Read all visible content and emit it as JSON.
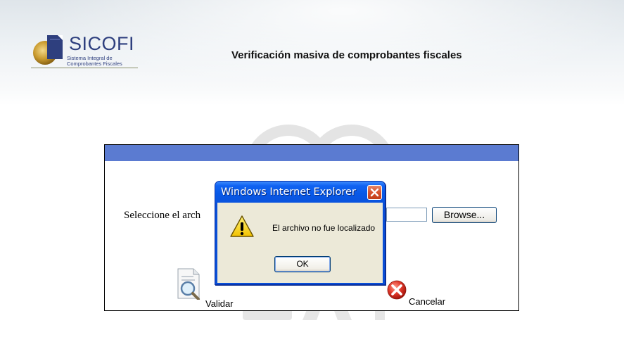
{
  "header": {
    "logo": {
      "wordmark": "SICOFI",
      "tagline_line1": "Sistema Integral de",
      "tagline_line2": "Comprobantes Fiscales"
    },
    "title": "Verificación masiva de comprobantes fiscales"
  },
  "watermark": {
    "text": "SAT"
  },
  "form": {
    "file_label": "Seleccione el arch",
    "file_value": "",
    "browse_label": "Browse...",
    "validate_label": "Validar",
    "cancel_label": "Cancelar"
  },
  "dialog": {
    "title": "Windows Internet Explorer",
    "message": "El archivo no fue localizado",
    "ok_label": "OK",
    "icon": "warning-icon",
    "close_icon": "close-icon"
  },
  "colors": {
    "panel_header": "#5b7bd1",
    "dialog_title_bar": "#0a53dd",
    "dialog_body": "#ece9d8",
    "brand_text": "#2e3f7e"
  }
}
